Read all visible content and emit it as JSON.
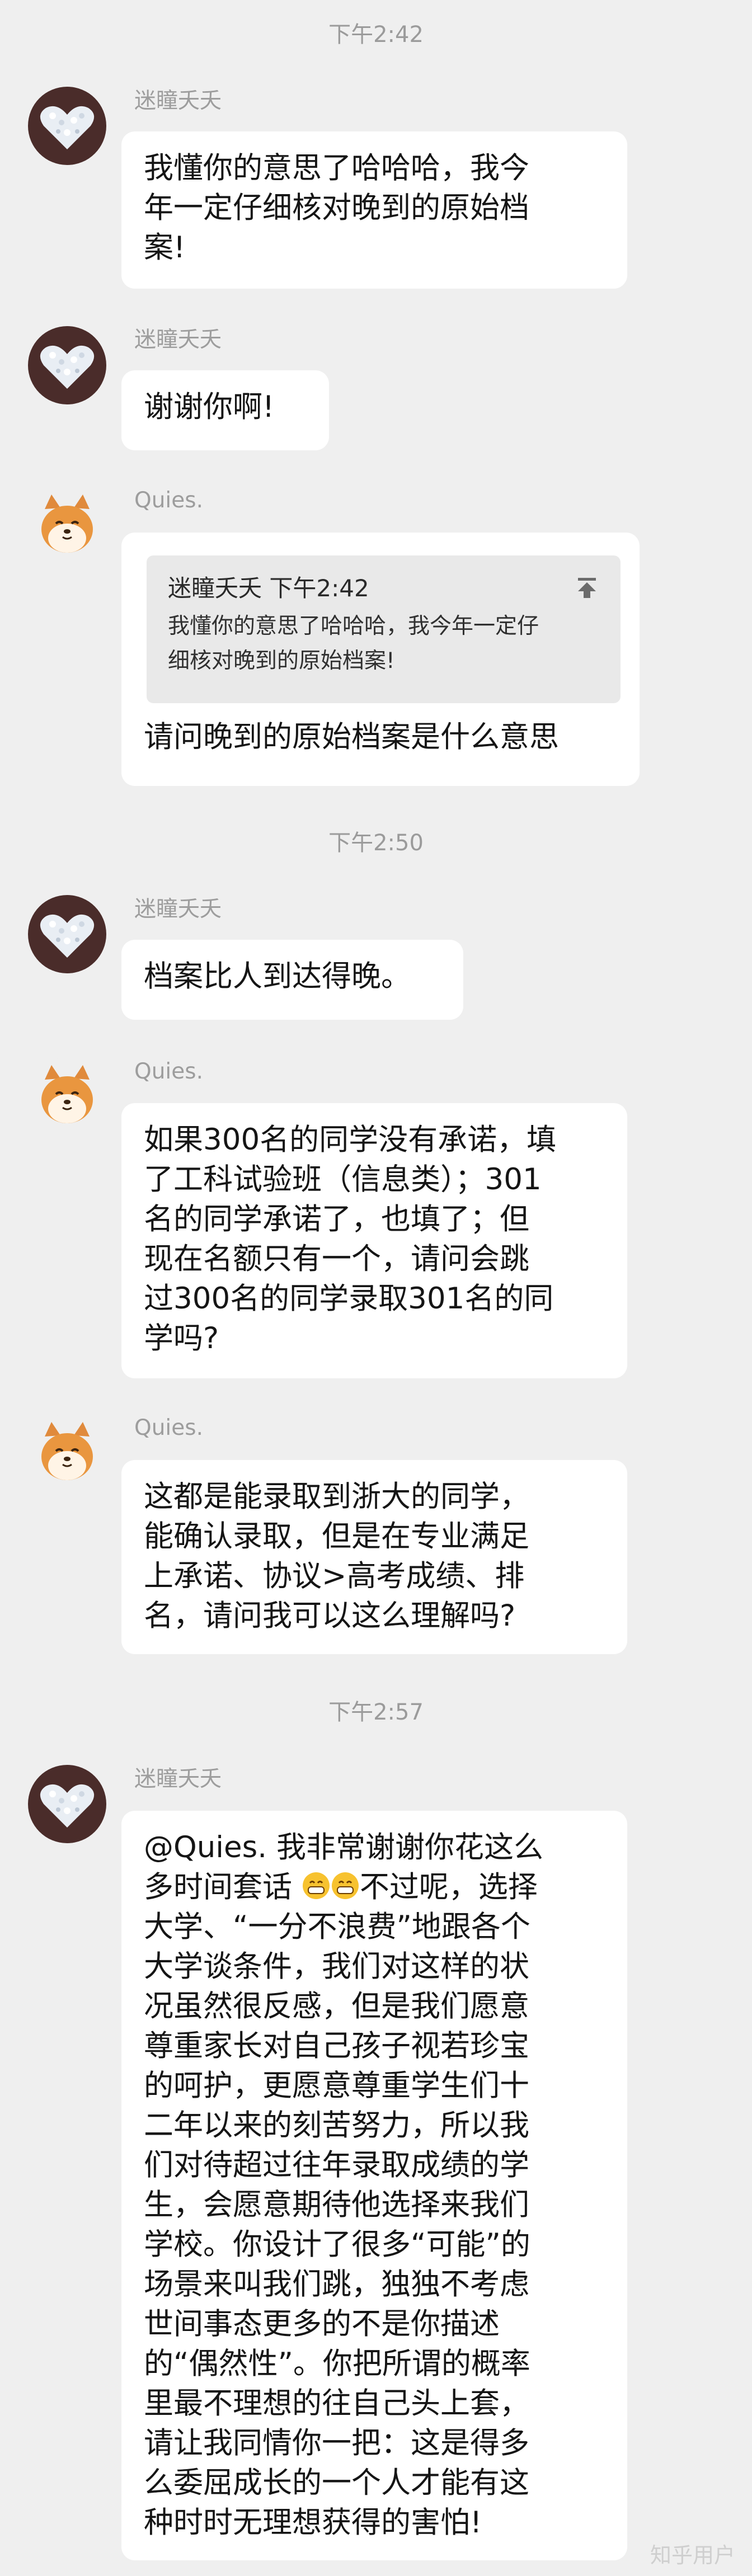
{
  "timestamps": [
    "下午2:42",
    "下午2:50",
    "下午2:57"
  ],
  "users": {
    "a": "迷瞳夭夭",
    "b": "Quies."
  },
  "messages": [
    {
      "lines": [
        "我懂你的意思了哈哈哈，我今",
        "年一定仔细核对晚到的原始档",
        "案!"
      ]
    },
    {
      "lines": [
        "谢谢你啊!"
      ]
    },
    {
      "quote": {
        "author": "迷瞳夭夭",
        "time": "下午2:42",
        "lines": [
          "我懂你的意思了哈哈哈，我今年一定仔",
          "细核对晚到的原始档案!"
        ]
      },
      "lines": [
        "请问晚到的原始档案是什么意思"
      ]
    },
    {
      "lines": [
        "档案比人到达得晚。"
      ]
    },
    {
      "lines": [
        "如果300名的同学没有承诺，填",
        "了工科试验班（信息类）；301",
        "名的同学承诺了，也填了；但",
        "现在名额只有一个，请问会跳",
        "过300名的同学录取301名的同",
        "学吗?"
      ]
    },
    {
      "lines": [
        "这都是能录取到浙大的同学，",
        "能确认录取，但是在专业满足",
        "上承诺、协议>高考成绩、排",
        "名，请问我可以这么理解吗?"
      ]
    },
    {
      "first_line": {
        "before": "@Quies. 我非常谢谢你花这么",
        "middle": "多时间套话",
        "after": "不过呢，选择"
      },
      "lines": [
        "大学、“一分不浪费”地跟各个",
        "大学谈条件，我们对这样的状",
        "况虽然很反感，但是我们愿意",
        "尊重家长对自己孩子视若珍宝",
        "的呵护，更愿意尊重学生们十",
        "二年以来的刻苦努力，所以我",
        "们对待超过往年录取成绩的学",
        "生，会愿意期待他选择来我们",
        "学校。你设计了很多“可能”的",
        "场景来叫我们跳，独独不考虑",
        "世间事态更多的不是你描述",
        "的“偶然性”。你把所谓的概率",
        "里最不理想的往自己头上套，",
        "请让我同情你一把：这是得多",
        "么委屈成长的一个人才能有这",
        "种时时无理想获得的害怕!"
      ]
    }
  ],
  "watermark": "知乎用户",
  "icons": {
    "avatar_a": "avatar-sparkle-heart-icon",
    "avatar_b": "avatar-shiba-dog-icon",
    "quote_jump": "jump-to-top-icon",
    "emoji": "grinning-emoji-icon"
  }
}
